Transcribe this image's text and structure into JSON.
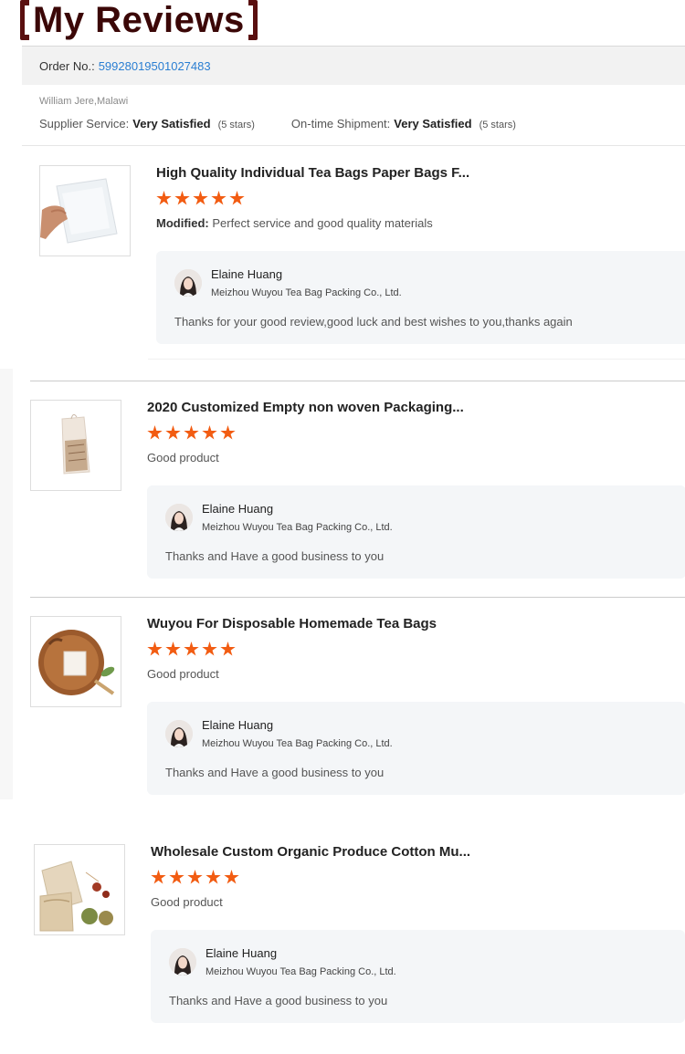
{
  "page": {
    "title": "My Reviews"
  },
  "order": {
    "label": "Order No.:",
    "number": "59928019501027483",
    "buyer": "William Jere,Malawi",
    "supplier_service_label": "Supplier Service:",
    "supplier_service_value": "Very Satisfied",
    "supplier_service_stars": "(5 stars)",
    "shipment_label": "On-time Shipment:",
    "shipment_value": "Very Satisfied",
    "shipment_stars": "(5 stars)"
  },
  "reviews": [
    {
      "product_title": "High Quality Individual Tea Bags Paper Bags F...",
      "rating": 5,
      "modified_label": "Modified:",
      "text": "Perfect service and good quality materials",
      "reply_name": "Elaine Huang",
      "reply_company": "Meizhou Wuyou Tea Bag Packing Co., Ltd.",
      "reply_text": "Thanks for your good review,good luck and best wishes to you,thanks again"
    },
    {
      "product_title": "2020 Customized Empty non woven Packaging...",
      "rating": 5,
      "text": "Good product",
      "reply_name": "Elaine Huang",
      "reply_company": "Meizhou Wuyou Tea Bag Packing Co., Ltd.",
      "reply_text": "Thanks and Have a good business to you"
    },
    {
      "product_title": "Wuyou For Disposable Homemade Tea Bags",
      "rating": 5,
      "text": "Good product",
      "reply_name": "Elaine Huang",
      "reply_company": "Meizhou Wuyou Tea Bag Packing Co., Ltd.",
      "reply_text": "Thanks and Have a good business to you"
    },
    {
      "product_title": "Wholesale Custom Organic Produce Cotton Mu...",
      "rating": 5,
      "text": "Good product",
      "reply_name": "Elaine Huang",
      "reply_company": "Meizhou Wuyou Tea Bag Packing Co., Ltd.",
      "reply_text": "Thanks and Have a good business to you"
    }
  ],
  "colors": {
    "title": "#3b0707",
    "bracket": "#5a0f0f",
    "order_link": "#2a7ed2",
    "star": "#f25c12",
    "reply_bg": "#f4f6f8"
  },
  "icons": {
    "star": "star-icon",
    "avatar": "seller-avatar"
  }
}
